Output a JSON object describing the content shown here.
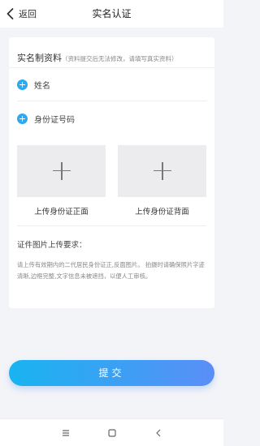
{
  "header": {
    "back_label": "返回",
    "title": "实名认证"
  },
  "form": {
    "section_title": "实名制资料",
    "section_note": "（资料提交后无法修改，请填写真实资料）",
    "fields": [
      {
        "label": "姓名",
        "icon": "plus-circle-icon"
      },
      {
        "label": "身份证号码",
        "icon": "plus-circle-icon"
      }
    ],
    "uploads": [
      {
        "label": "上传身份证正面",
        "icon": "plus-icon"
      },
      {
        "label": "上传身份证背面",
        "icon": "plus-icon"
      }
    ],
    "requirements_title": "证件图片上传要求：",
    "requirements_text": "请上传有效期内的二代居民身份证正,反面图片。 拍摄时请确保照片字迹清晰,边框完整,文字信息未被遮挡，以便人工审核。"
  },
  "submit": {
    "label": "提交"
  },
  "colors": {
    "accent": "#2aaaf3",
    "button_start": "#19b4f1",
    "button_end": "#5a8ef7",
    "background": "#f3f4f8"
  },
  "system_nav": {
    "icons": [
      "menu-icon",
      "home-square-icon",
      "back-triangle-icon"
    ]
  }
}
